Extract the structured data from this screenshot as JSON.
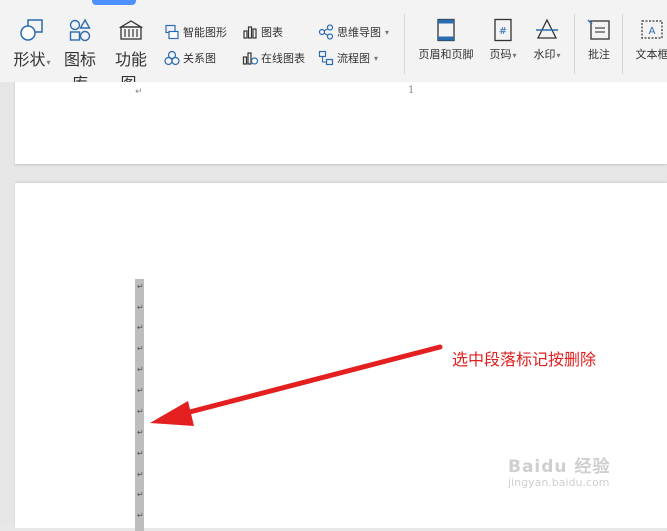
{
  "toolbar": {
    "buttons": {
      "shape": "形状",
      "icon_library": "图标库",
      "function_chart": "功能图",
      "smart_graphic": "智能图形",
      "chart": "图表",
      "mind_map": "思维导图",
      "relation_chart": "关系图",
      "online_chart": "在线图表",
      "flowchart": "流程图",
      "header_footer": "页眉和页脚",
      "page_number": "页码",
      "watermark": "水印",
      "comment": "批注",
      "textbox": "文本框"
    },
    "accent_color": "#4d90fe"
  },
  "document": {
    "page1_paragraph_mark": "↵",
    "page1_number": "1",
    "selected_paragraph_marks": [
      "↵",
      "↵",
      "↵",
      "↵",
      "↵",
      "↵",
      "↵",
      "↵",
      "↵",
      "↵",
      "↵",
      "↵",
      "↵"
    ]
  },
  "annotation": {
    "text": "选中段落标记按删除",
    "color": "#e02020"
  },
  "watermark": {
    "brand": "Baidu 经验",
    "url": "jingyan.baidu.com"
  }
}
